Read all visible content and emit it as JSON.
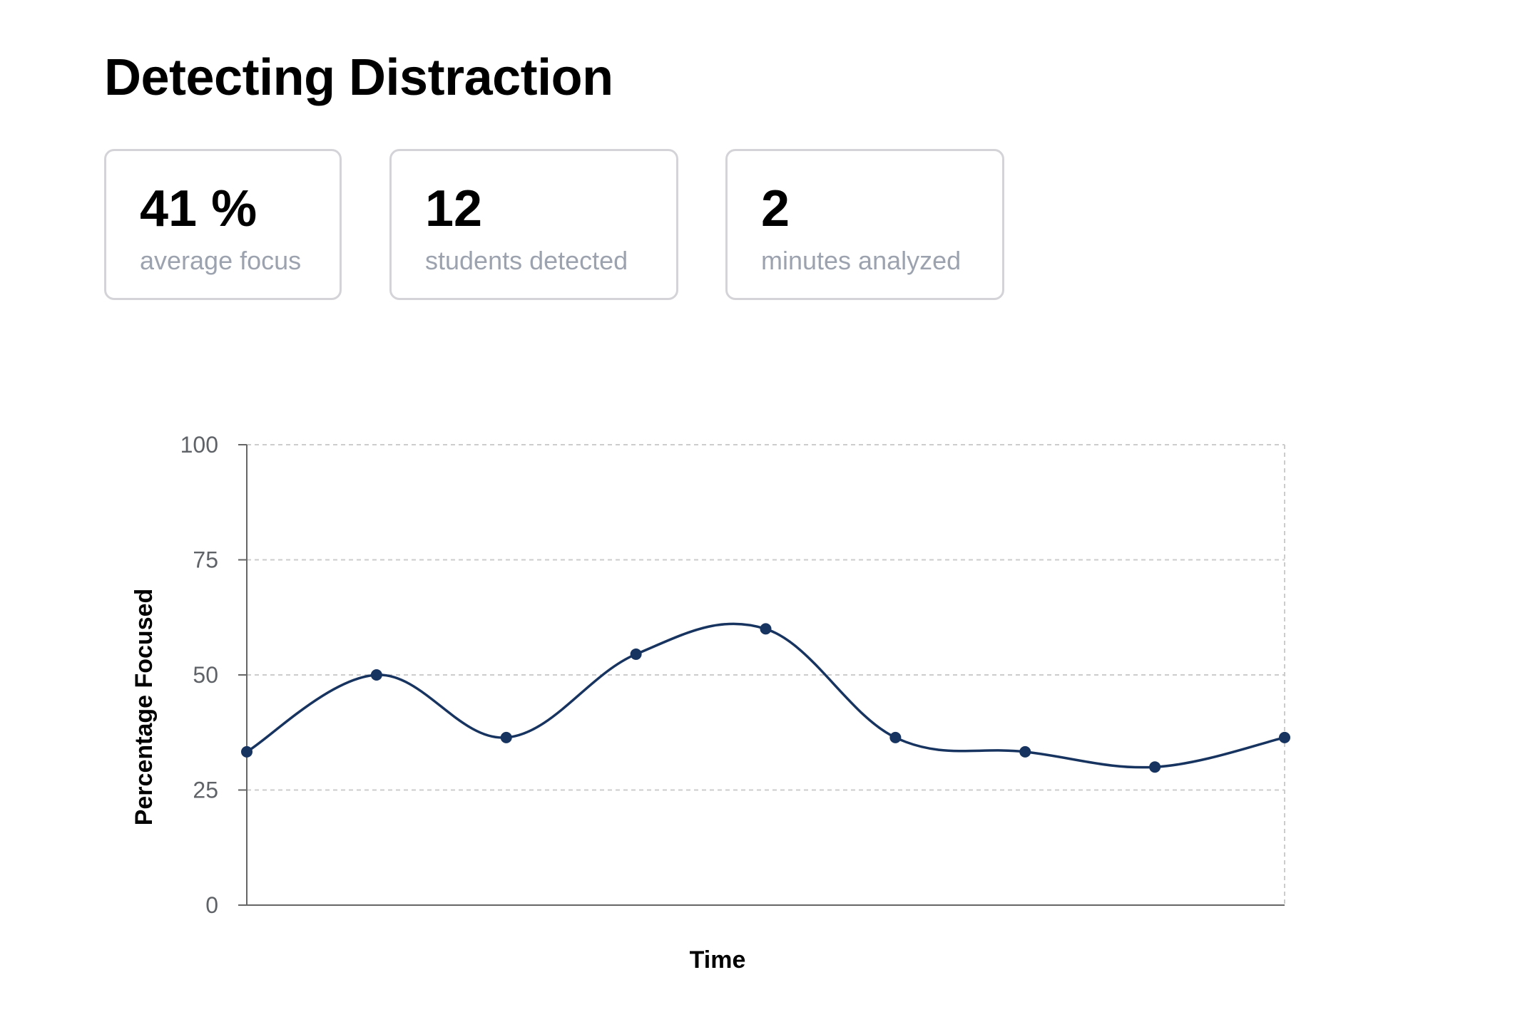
{
  "page": {
    "title": "Detecting Distraction"
  },
  "stats": [
    {
      "value": "41 %",
      "label": "average focus"
    },
    {
      "value": "12",
      "label": "students detected"
    },
    {
      "value": "2",
      "label": "minutes analyzed"
    }
  ],
  "chart_data": {
    "type": "line",
    "title": "",
    "xlabel": "Time",
    "ylabel": "Percentage Focused",
    "ylim": [
      0,
      100
    ],
    "yticks": [
      "0",
      "25",
      "50",
      "75",
      "100"
    ],
    "x": [
      1,
      2,
      3,
      4,
      5,
      6,
      7,
      8,
      9
    ],
    "series": [
      {
        "values": [
          33.3,
          50,
          36.4,
          54.5,
          60,
          36.4,
          33.3,
          30,
          36.4
        ],
        "color": "#17335f"
      }
    ],
    "grid": true,
    "line_style": "smooth",
    "axis_color": "#666666",
    "grid_color": "#cccccc"
  }
}
